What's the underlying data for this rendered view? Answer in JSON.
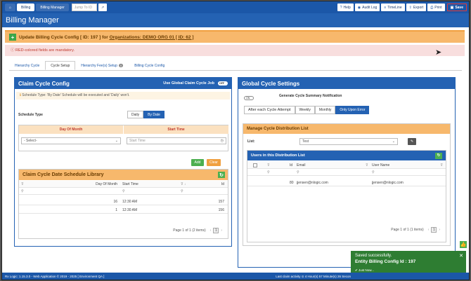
{
  "topbar": {
    "home_icon": "home-icon",
    "breadcrumbs": [
      "Billing",
      "Billing Manager"
    ],
    "jump_placeholder": "Jump To ID",
    "buttons": [
      {
        "label": "Help",
        "icon": "question-icon"
      },
      {
        "label": "Audit Log",
        "icon": "eye-icon"
      },
      {
        "label": "TimeLine",
        "icon": "list-icon"
      },
      {
        "label": "Export",
        "icon": "export-icon"
      },
      {
        "label": "Print",
        "icon": "print-icon"
      }
    ],
    "save_label": "Save"
  },
  "app_title": "Billing Manager",
  "header": {
    "prefix": "Update Billing Cycle Config [ ID: 197 ] for",
    "org": "Organizations: DEMO ORG 01 [ ID: 62 ]"
  },
  "mandatory_note": "RED-colored fields are mandatory.",
  "tabs": [
    "Hierarchy Cycle",
    "Cycle Setup",
    "Hierarchy Fee(s) Setup",
    "Billing Cycle Config"
  ],
  "tab_badge": "0",
  "claim": {
    "title": "Claim Cycle Config",
    "global_label": "Use Global Claim Cycle Job",
    "global_toggle": "OFF",
    "note": "Schedule Type: 'By Date' Schedule will be executed and 'Daily' won't.",
    "schedule_type_label": "Schedule Type",
    "schedule_options": [
      "Daily",
      "By Date"
    ],
    "schedule_selected": "By Date",
    "day_of_month_header": "Day Of Month",
    "start_time_header": "Start Time",
    "day_select": "- Select-",
    "start_placeholder": "Start Time",
    "add_label": "Add",
    "clear_label": "Clear"
  },
  "library": {
    "title": "Claim Cycle Date Schedule Library",
    "columns": [
      "Day Of Month",
      "Start Time",
      "Id"
    ],
    "rows": [
      {
        "day": "16",
        "time": "12:30 AM",
        "id": "157"
      },
      {
        "day": "1",
        "time": "12:30 AM",
        "id": "156"
      }
    ],
    "pager": "Page 1 of 1 (2 items)",
    "page": "1"
  },
  "global": {
    "title": "Global Cycle Settings",
    "toggle": "ON",
    "gen_label": "Generate Cycle Summary Notification",
    "options": [
      "After each Cycle Attempt",
      "Weekly",
      "Monthly",
      "Only Upon Error"
    ],
    "selected": "Only Upon Error",
    "manage_title": "Manage Cycle Distribution List",
    "list_label": "List:",
    "list_value": "Test",
    "users_title": "Users in this Distribution List",
    "columns": [
      "Id",
      "Email",
      "User Name"
    ],
    "rows": [
      {
        "id": "80",
        "email": "jjensen@nlogic.com",
        "user": "jjensen@nlogic.com"
      }
    ],
    "pager": "Page 1 of 1 (1 items)",
    "page": "1"
  },
  "toast": {
    "title": "Saved successfully.",
    "message": "Entity Billing Config Id : 197",
    "time": "Just Now..."
  },
  "footer": {
    "left": "Rx Logic: 1.15.3.0 - Web Application © 2019 - 2025 [ Environment QA ]",
    "right": "Last claim activity ⊙ 4 Hour(s) 57 Minute(s) 26 Secon"
  },
  "colors": {
    "primary": "#2462b3",
    "accent": "#f7b86c",
    "success": "#2e7d32"
  }
}
